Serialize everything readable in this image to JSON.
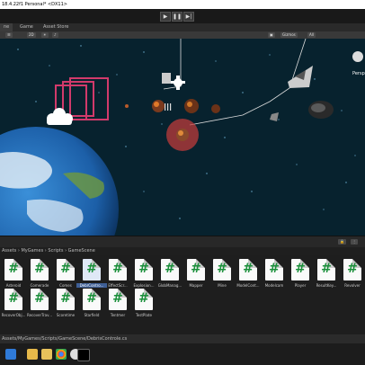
{
  "window": {
    "title": "18.4.22f1 Personal* <DX11>"
  },
  "playbar": {
    "play": "▶",
    "pause": "❚❚",
    "step": "▶|"
  },
  "tabs": [
    {
      "label": "ne",
      "active": true
    },
    {
      "label": "Game",
      "active": false
    },
    {
      "label": "Asset Store",
      "active": false
    }
  ],
  "scene_tools": {
    "mode": "2D",
    "gizmos": "Gizmos",
    "search": "All"
  },
  "scene": {
    "label": "Persp"
  },
  "breadcrumb": {
    "text": "Assets  ›  MyGames  ›  Scripts  ›  GameScene"
  },
  "files": [
    "Asteroid",
    "Comerade",
    "Comes",
    "DebrContro...",
    "EffectScr...",
    "Explosion...",
    "GlobManag...",
    "Mapper",
    "Mine",
    "ModelCont...",
    "Modelcam",
    "Player",
    "ResultKey...",
    "Revolver",
    "RecoverObj...",
    "RecoverTrav...",
    "Scoretime",
    "Starfield",
    "Tentmer",
    "TestPlate"
  ],
  "selected_file_index": 3,
  "pathbar": {
    "text": "Assets/MyGames/Scripts/GameScene/DebrisControle.cs"
  },
  "taskbar": {
    "icons": [
      "windows-icon",
      "explorer-icon",
      "folder-icon",
      "chrome-icon",
      "steam-icon",
      "unity-icon"
    ]
  },
  "colors": {
    "accent": "#3e5f96",
    "scene_bg": "#07222e",
    "hash_green": "#1a8f3a"
  }
}
